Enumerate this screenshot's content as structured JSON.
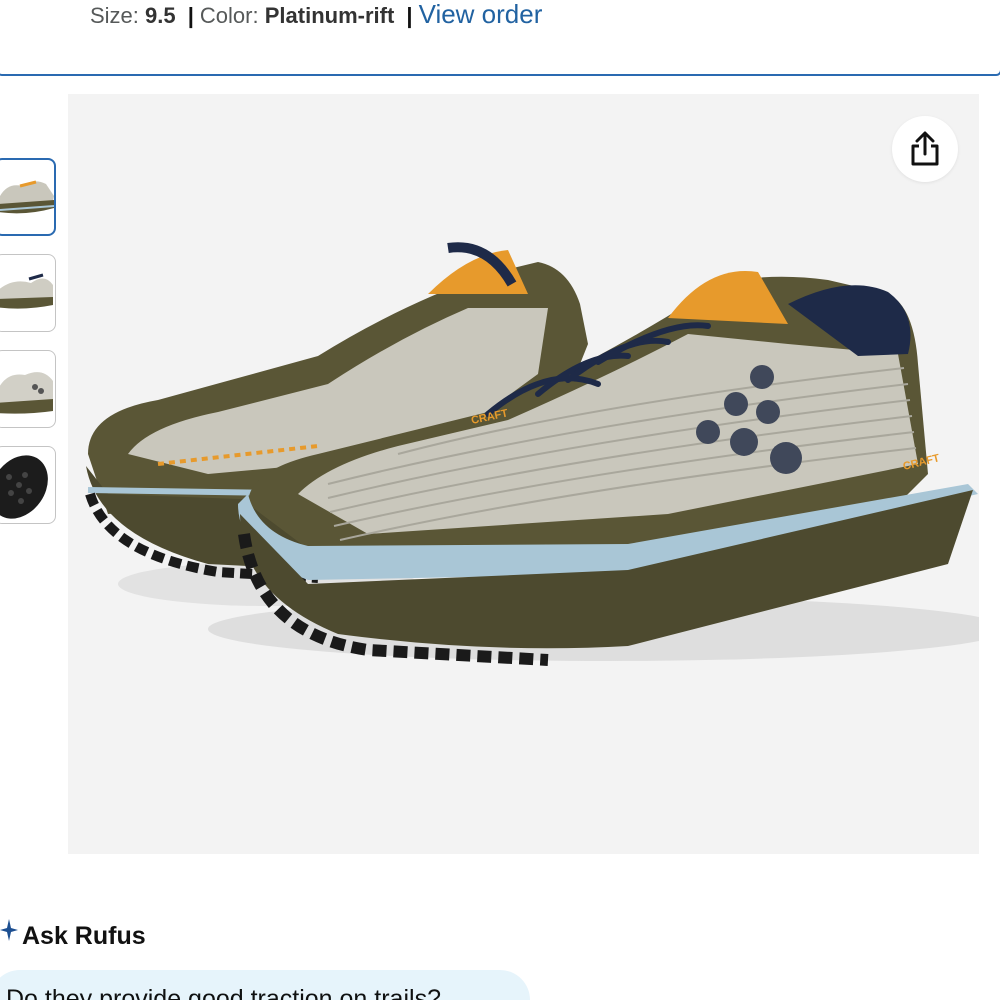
{
  "order_banner": {
    "size_label": "Size:",
    "size_value": "9.5",
    "color_label": "Color:",
    "color_value": "Platinum-rift",
    "separator": "|",
    "view_order_link": "View order"
  },
  "product_image": {
    "alt": "Craft trail running shoes, olive green with light grey knit upper, navy laces, orange accents",
    "brand_marks": [
      "CRAFT",
      "CRAFT"
    ]
  },
  "share": {
    "icon": "share-icon"
  },
  "thumbnails": [
    {
      "name": "thumbnail-1",
      "selected": true
    },
    {
      "name": "thumbnail-2",
      "selected": false
    },
    {
      "name": "thumbnail-3",
      "selected": false
    },
    {
      "name": "thumbnail-4",
      "selected": false
    }
  ],
  "rufus": {
    "title": "Ask Rufus",
    "suggestion": "Do they provide good traction on trails?"
  },
  "colors": {
    "link_blue": "#2162a1",
    "selected_border": "#2a6ab1",
    "chip_background": "#e6f4fb",
    "shoe_olive": "#5a5636",
    "shoe_knit": "#c9c7bc",
    "lace_navy": "#1e2a48",
    "accent_orange": "#e79a2c",
    "midsole_blue": "#a9c6d6"
  }
}
